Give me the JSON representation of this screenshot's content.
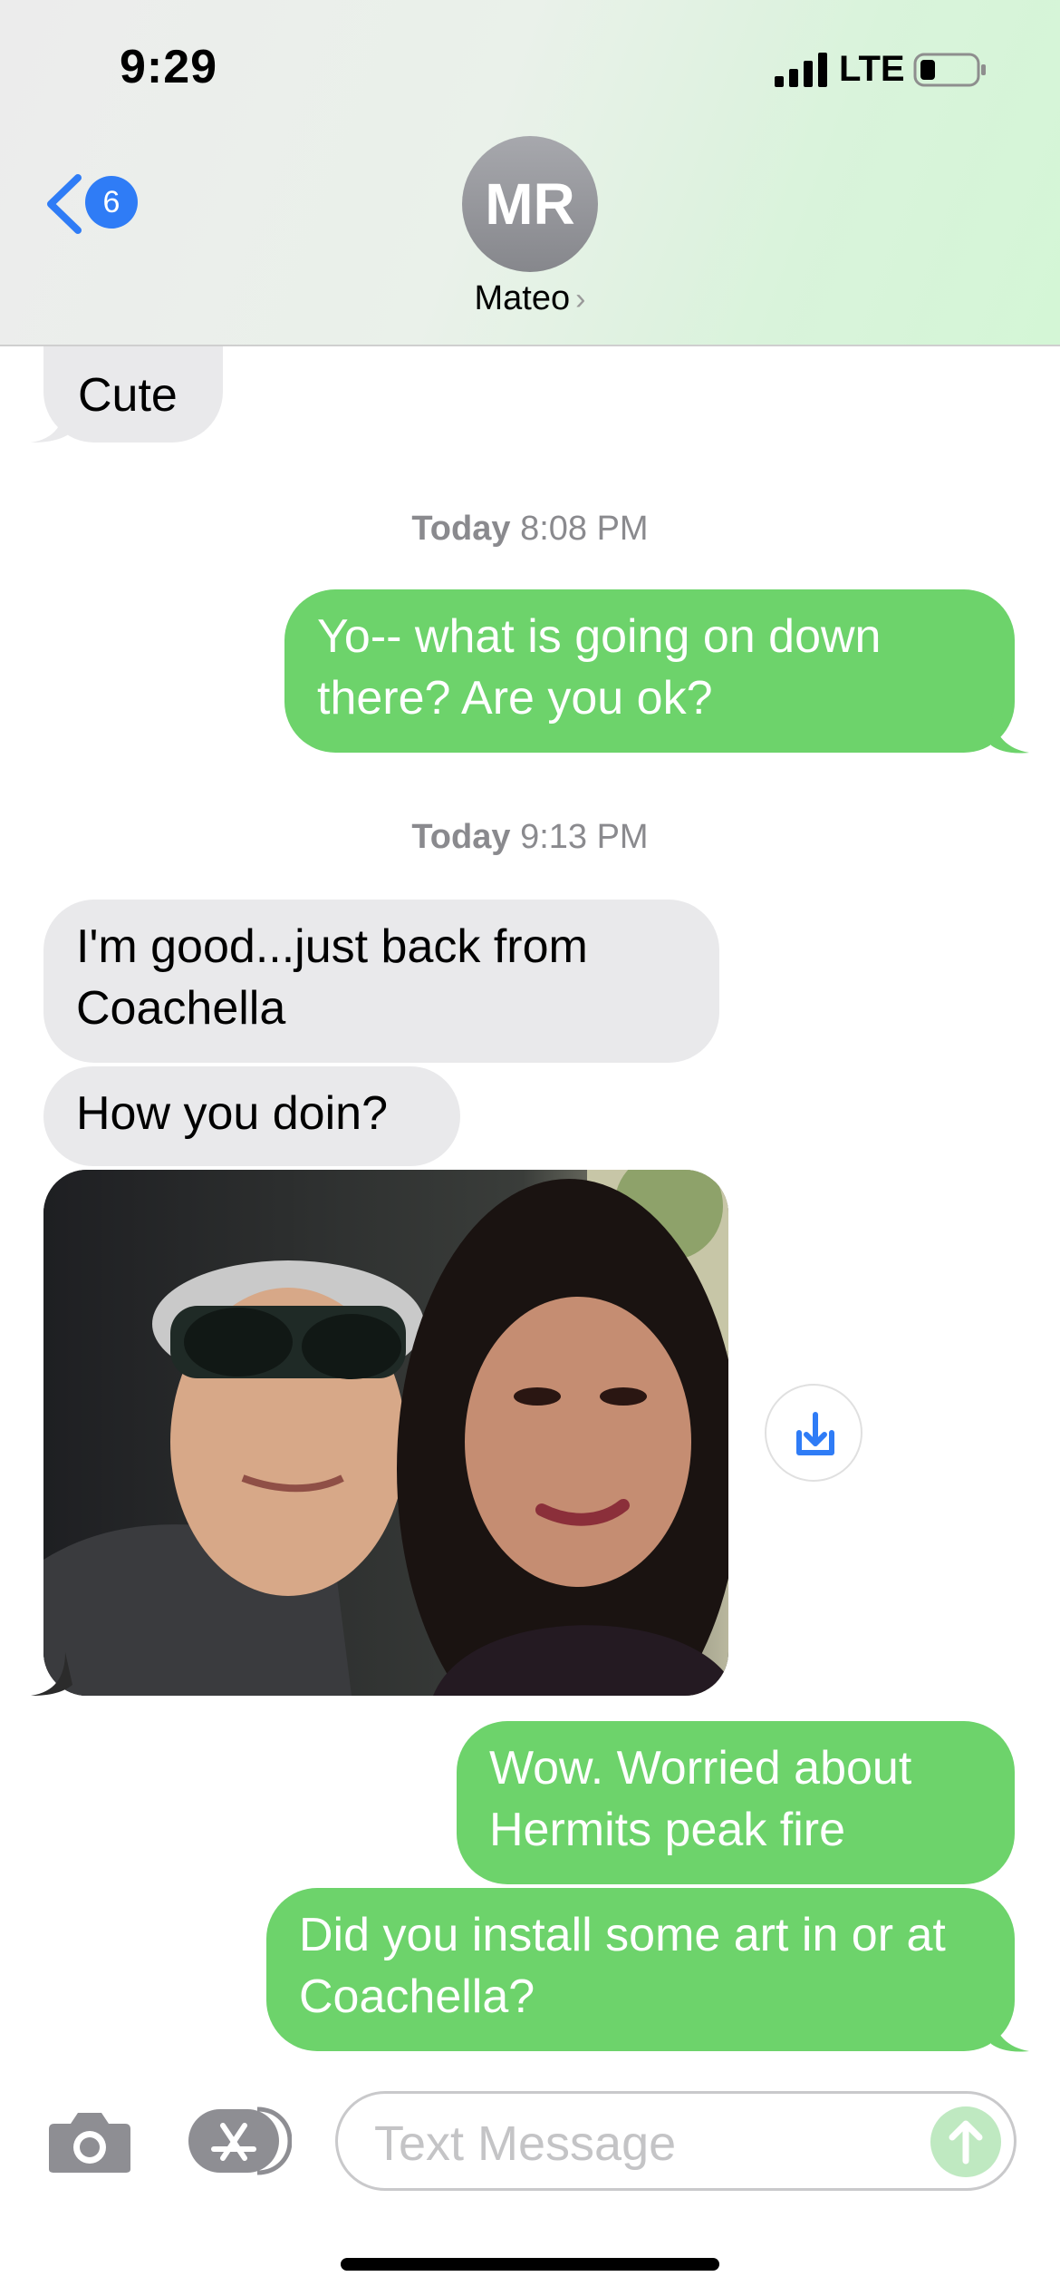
{
  "status_bar": {
    "time": "9:29",
    "network": "LTE"
  },
  "header": {
    "unread_count": "6",
    "avatar_initials": "MR",
    "contact_name": "Mateo"
  },
  "messages": {
    "m1": "Cute",
    "stamp1_day": "Today",
    "stamp1_time": "8:08 PM",
    "m2": "Yo-- what is going on down there? Are you ok?",
    "stamp2_day": "Today",
    "stamp2_time": "9:13 PM",
    "m3": "I'm good...just back from Coachella",
    "m4": "How you doin?",
    "m5": "Wow. Worried about Hermits peak fire",
    "m6": "Did you install some art in or at Coachella?"
  },
  "composer": {
    "placeholder": "Text Message"
  },
  "colors": {
    "sent_bubble": "#6dd36b",
    "received_bubble": "#e9e9eb",
    "accent": "#2f7cf6"
  },
  "icons": {
    "back": "chevron-left-icon",
    "camera": "camera-icon",
    "apps": "app-store-icon",
    "send": "arrow-up-icon",
    "save": "download-icon"
  }
}
